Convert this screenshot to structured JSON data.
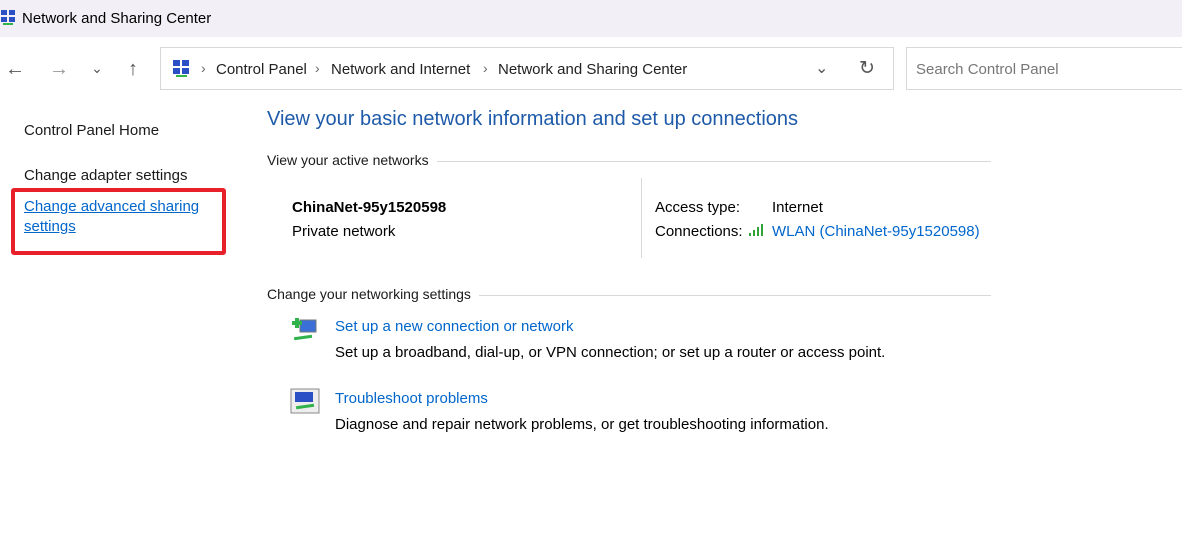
{
  "window": {
    "title": "Network and Sharing Center"
  },
  "address": {
    "crumbs": [
      "Control Panel",
      "Network and Internet",
      "Network and Sharing Center"
    ]
  },
  "search": {
    "placeholder": "Search Control Panel"
  },
  "sidebar": {
    "items": [
      {
        "label": "Control Panel Home"
      },
      {
        "label": "Change adapter settings"
      },
      {
        "label": "Change advanced sharing settings"
      }
    ]
  },
  "main": {
    "heading": "View your basic network information and set up connections",
    "active_header": "View your active networks",
    "network": {
      "name": "ChinaNet-95y1520598",
      "type": "Private network",
      "access_label": "Access type:",
      "access_value": "Internet",
      "connections_label": "Connections:",
      "connections_value": "WLAN (ChinaNet-95y1520598)"
    },
    "settings_header": "Change your networking settings",
    "tasks": [
      {
        "title": "Set up a new connection or network",
        "desc": "Set up a broadband, dial-up, or VPN connection; or set up a router or access point."
      },
      {
        "title": "Troubleshoot problems",
        "desc": "Diagnose and repair network problems, or get troubleshooting information."
      }
    ]
  },
  "colors": {
    "link": "#0066cc",
    "heading": "#1e5aa8",
    "highlight": "#e8202a"
  }
}
